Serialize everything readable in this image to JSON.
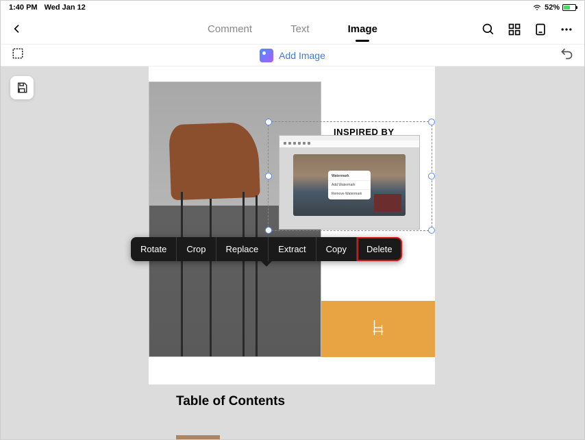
{
  "status": {
    "time": "1:40 PM",
    "date": "Wed Jan 12",
    "battery_pct": "52%"
  },
  "nav": {
    "tabs": {
      "comment": "Comment",
      "text": "Text",
      "image": "Image"
    }
  },
  "toolbar": {
    "add_image": "Add Image"
  },
  "page": {
    "inspired": "INSPIRED BY",
    "toc": "Table of Contents",
    "thumb_menu": {
      "title": "Watermark",
      "item1": "Add Watermark",
      "item2": "Remove Watermark"
    }
  },
  "context_menu": {
    "rotate": "Rotate",
    "crop": "Crop",
    "replace": "Replace",
    "extract": "Extract",
    "copy": "Copy",
    "delete": "Delete"
  }
}
